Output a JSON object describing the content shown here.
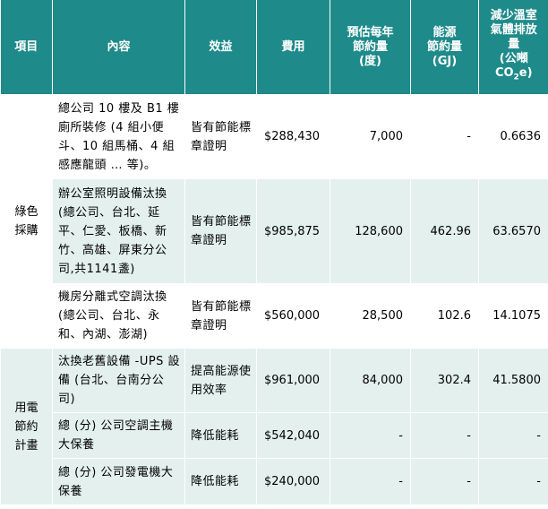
{
  "headers": {
    "item": "項目",
    "content": "內容",
    "benefit": "效益",
    "cost": "費用",
    "kwh_line1": "預估每年",
    "kwh_line2": "節約量",
    "kwh_line3": "(度)",
    "gj_line1": "能源",
    "gj_line2": "節約量",
    "gj_line3": "(GJ)",
    "co2_line1": "減少溫室",
    "co2_line2": "氣體排放",
    "co2_line3": "量",
    "co2_line4": "(公噸",
    "co2_unit_a": "CO",
    "co2_unit_sub": "2",
    "co2_unit_b": "e)"
  },
  "categories": {
    "green": "綠色採購",
    "power": "用電節約計畫"
  },
  "rows": [
    {
      "content": "總公司 10 樓及 B1 樓廁所裝修 (4 組小便斗、10 組馬桶、4 組感應龍頭 … 等)。",
      "benefit": "皆有節能標章證明",
      "cost": "$288,430",
      "kwh": "7,000",
      "gj": "-",
      "co2": "0.6636"
    },
    {
      "content": "辦公室照明設備汰換 (總公司、台北、延平、仁愛、板橋、新竹、高雄、屏東分公司,共1141盞)",
      "benefit": "皆有節能標章證明",
      "cost": "$985,875",
      "kwh": "128,600",
      "gj": "462.96",
      "co2": "63.6570"
    },
    {
      "content": "機房分離式空調汰換 (總公司、台北、永和、內湖、澎湖)",
      "benefit": "皆有節能標章證明",
      "cost": "$560,000",
      "kwh": "28,500",
      "gj": "102.6",
      "co2": "14.1075"
    },
    {
      "content": "汰換老舊設備 -UPS 設備 (台北、台南分公司)",
      "benefit": "提高能源使用效率",
      "cost": "$961,000",
      "kwh": "84,000",
      "gj": "302.4",
      "co2": "41.5800"
    },
    {
      "content": "總 (分) 公司空調主機大保養",
      "benefit": "降低能耗",
      "cost": "$542,040",
      "kwh": "-",
      "gj": "-",
      "co2": "-"
    },
    {
      "content": "總 (分) 公司發電機大保養",
      "benefit": "降低能耗",
      "cost": "$240,000",
      "kwh": "-",
      "gj": "-",
      "co2": "-"
    }
  ]
}
